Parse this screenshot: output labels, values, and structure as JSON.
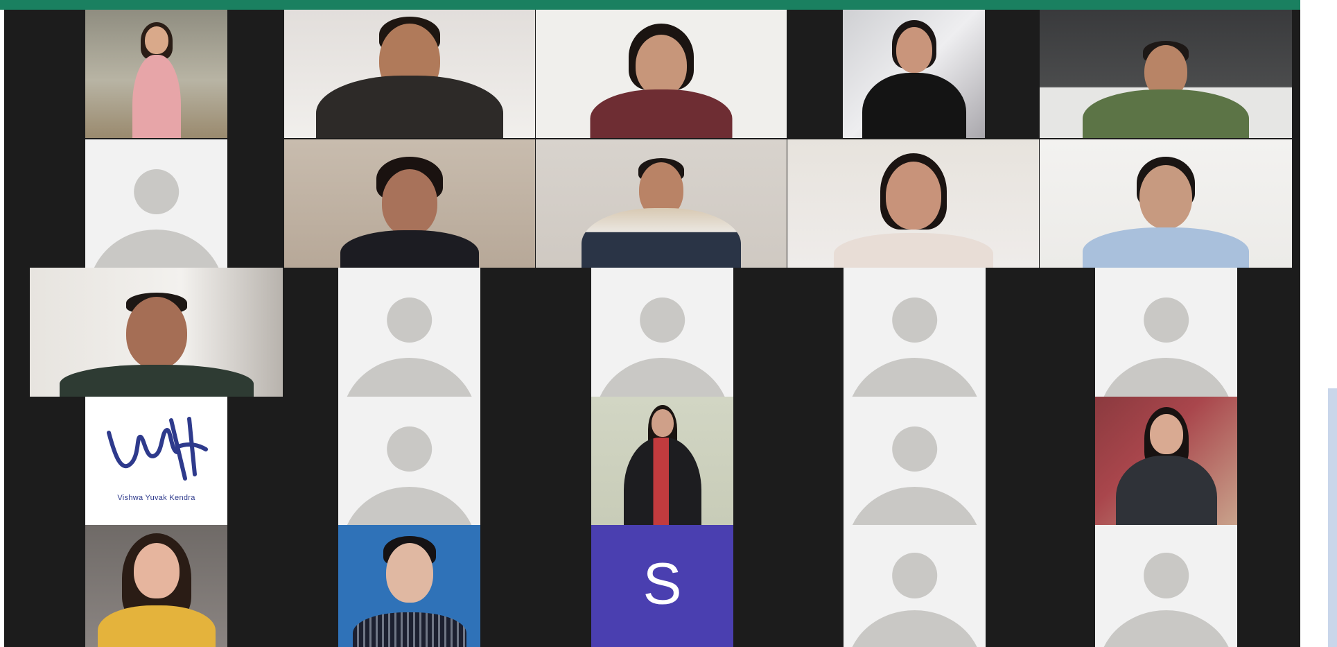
{
  "colors": {
    "accent": "#1a8060",
    "stage": "#1c1c1c",
    "avatar_bg": "#f2f2f2",
    "avatar_shape": "#c9c8c5",
    "letter_tile": "#4a3fb0",
    "logo": "#2e3a8c"
  },
  "tiles": {
    "logo": {
      "icon": "vyk-logo-icon",
      "text": "Vishwa Yuvak Kendra"
    },
    "letter": {
      "text": "S"
    }
  }
}
